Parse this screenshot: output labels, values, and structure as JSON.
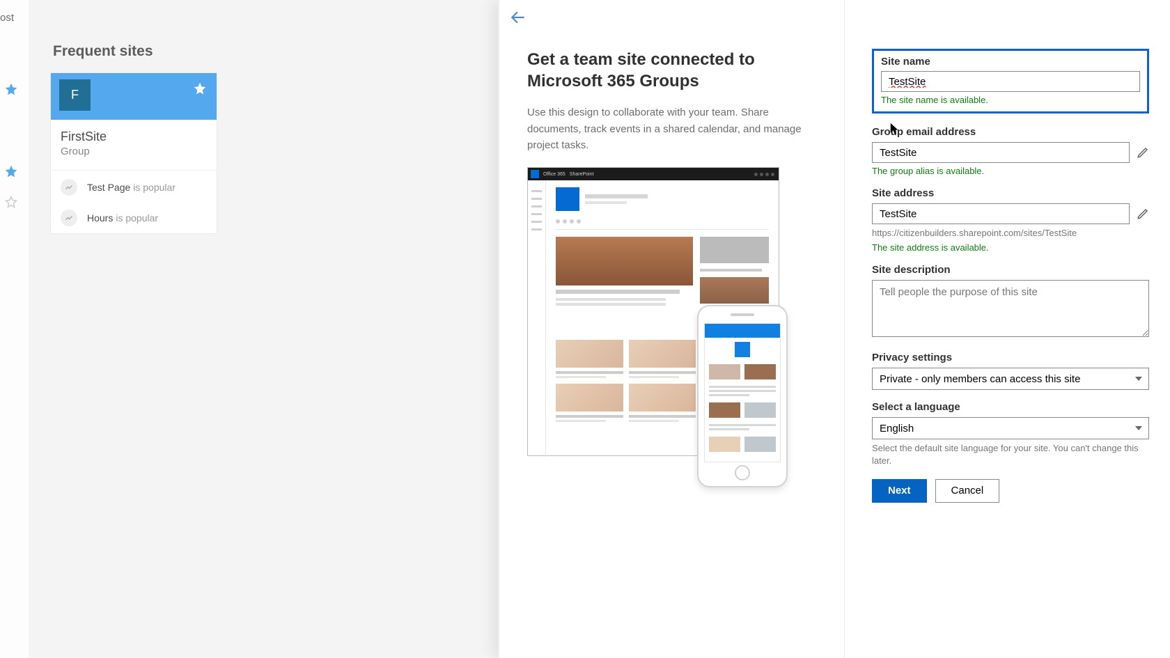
{
  "top_nav": {
    "post_link": "s post"
  },
  "home": {
    "frequent_title": "Frequent sites",
    "card": {
      "initial": "F",
      "title": "FirstSite",
      "subtitle": "Group",
      "rows": [
        {
          "name": "Test Page",
          "suffix": "is popular"
        },
        {
          "name": "Hours",
          "suffix": "is popular"
        }
      ]
    }
  },
  "panel": {
    "heading": "Get a team site connected to Microsoft 365 Groups",
    "description": "Use this design to collaborate with your team. Share documents, track events in a shared calendar, and manage project tasks.",
    "mock_bar_office": "Office 365",
    "mock_bar_app": "SharePoint"
  },
  "form": {
    "site_name": {
      "label": "Site name",
      "value": "TestSite",
      "avail": "The site name is available."
    },
    "group_email": {
      "label": "Group email address",
      "value": "TestSite",
      "avail": "The group alias is available."
    },
    "site_address": {
      "label": "Site address",
      "value": "TestSite",
      "url": "https://citizenbuilders.sharepoint.com/sites/TestSite",
      "avail": "The site address is available."
    },
    "description": {
      "label": "Site description",
      "placeholder": "Tell people the purpose of this site"
    },
    "privacy": {
      "label": "Privacy settings",
      "value": "Private - only members can access this site"
    },
    "language": {
      "label": "Select a language",
      "value": "English",
      "hint": "Select the default site language for your site. You can't change this later."
    },
    "next": "Next",
    "cancel": "Cancel"
  }
}
